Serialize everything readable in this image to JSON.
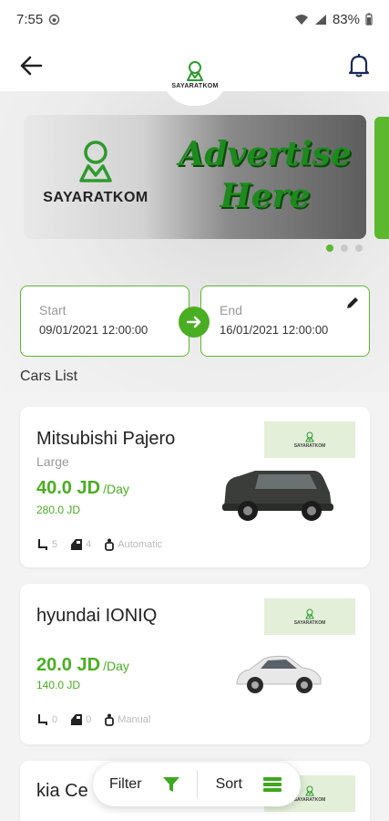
{
  "status_bar": {
    "time": "7:55",
    "battery": "83%"
  },
  "header": {
    "brand": "SAYARATKOM"
  },
  "banner": {
    "brand": "SAYARATKOM",
    "ad_line1": "Advertise",
    "ad_line2": "Here"
  },
  "dates": {
    "start_label": "Start",
    "start_value": "09/01/2021 12:00:00",
    "end_label": "End",
    "end_value": "16/01/2021 12:00:00"
  },
  "cars_list_title": "Cars List",
  "cars": [
    {
      "name": "Mitsubishi Pajero",
      "class": "Large",
      "price": "40.0 JD",
      "per": "/Day",
      "total": "280.0 JD",
      "seats": "5",
      "doors": "4",
      "transmission": "Automatic",
      "logo_text": "SAYARATKOM",
      "body_color": "#3a3d3a"
    },
    {
      "name": "hyundai IONIQ",
      "class": "",
      "price": "20.0 JD",
      "per": "/Day",
      "total": "140.0 JD",
      "seats": "0",
      "doors": "0",
      "transmission": "Manual",
      "logo_text": "SAYARATKOM",
      "body_color": "#e8e8e8"
    },
    {
      "name": "kia Ce",
      "logo_text": "SAYARATKOM"
    }
  ],
  "bottom_bar": {
    "filter_label": "Filter",
    "sort_label": "Sort"
  },
  "colors": {
    "accent": "#4aae22",
    "accent_light": "#5cb82e"
  }
}
